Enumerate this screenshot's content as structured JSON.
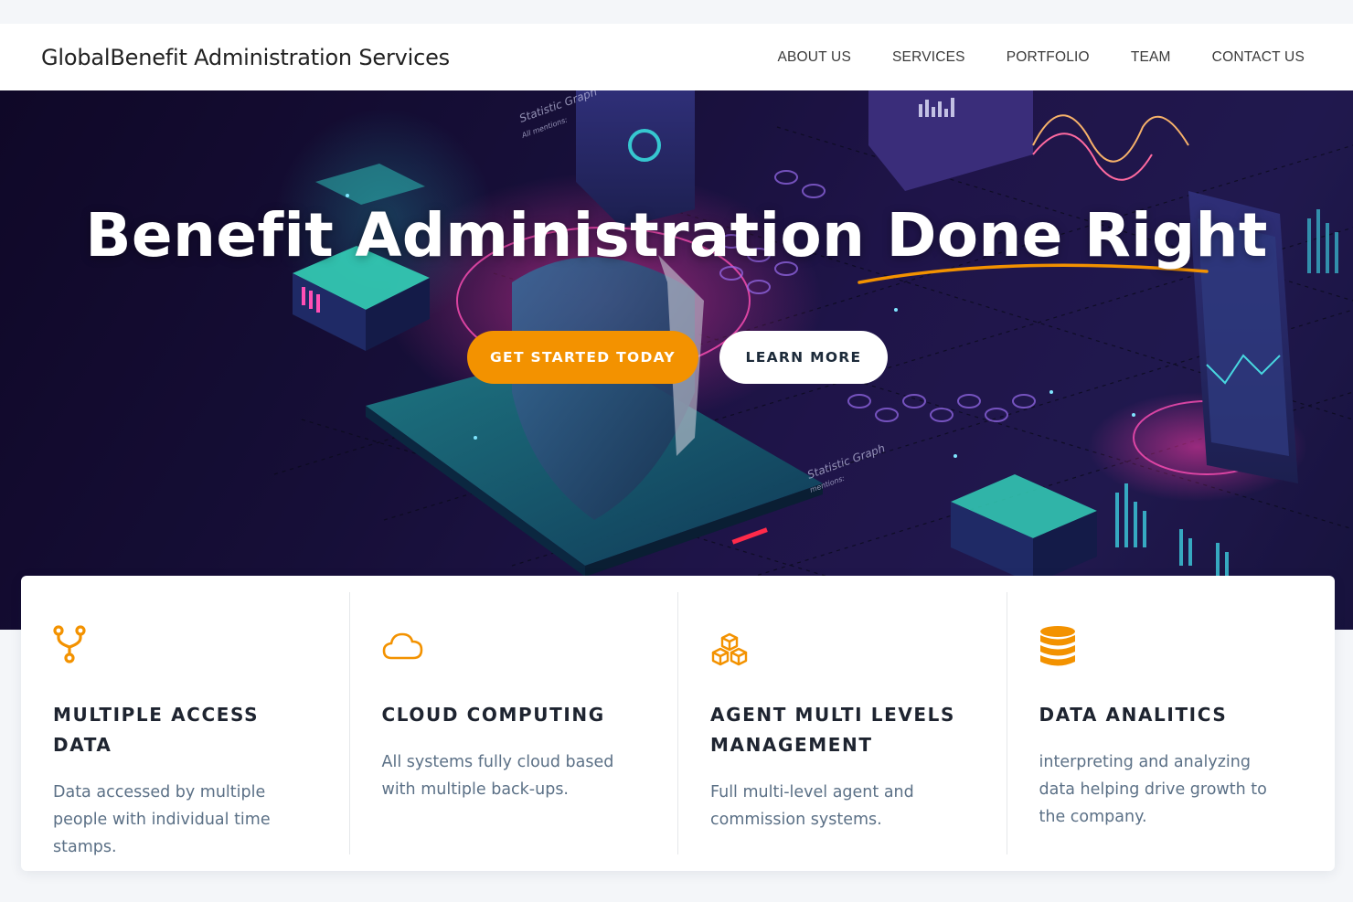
{
  "header": {
    "brand": "GlobalBenefit Administration Services",
    "nav": [
      {
        "label": "ABOUT US"
      },
      {
        "label": "SERVICES"
      },
      {
        "label": "PORTFOLIO"
      },
      {
        "label": "TEAM"
      },
      {
        "label": "CONTACT US"
      }
    ]
  },
  "hero": {
    "title": "Benefit Administration Done Right",
    "primary_button": "GET STARTED TODAY",
    "secondary_button": "LEARN MORE",
    "background_text": [
      "Statistic Graph",
      "All mentions:",
      "Statistic Graph",
      "mentions:"
    ]
  },
  "features": [
    {
      "icon": "fork-icon",
      "title": "MULTIPLE ACCESS DATA",
      "text": "Data accessed by multiple people with individual time stamps."
    },
    {
      "icon": "cloud-icon",
      "title": "CLOUD COMPUTING",
      "text": "All systems fully cloud based with multiple back-ups."
    },
    {
      "icon": "cubes-icon",
      "title": "AGENT MULTI LEVELS MANAGEMENT",
      "text": "Full multi-level agent and commission systems."
    },
    {
      "icon": "database-icon",
      "title": "DATA ANALITICS",
      "text": "interpreting and analyzing data helping drive growth to the company."
    }
  ],
  "colors": {
    "accent": "#f39200",
    "hero_bg": "#1d1444",
    "text_muted": "#5b7086"
  }
}
